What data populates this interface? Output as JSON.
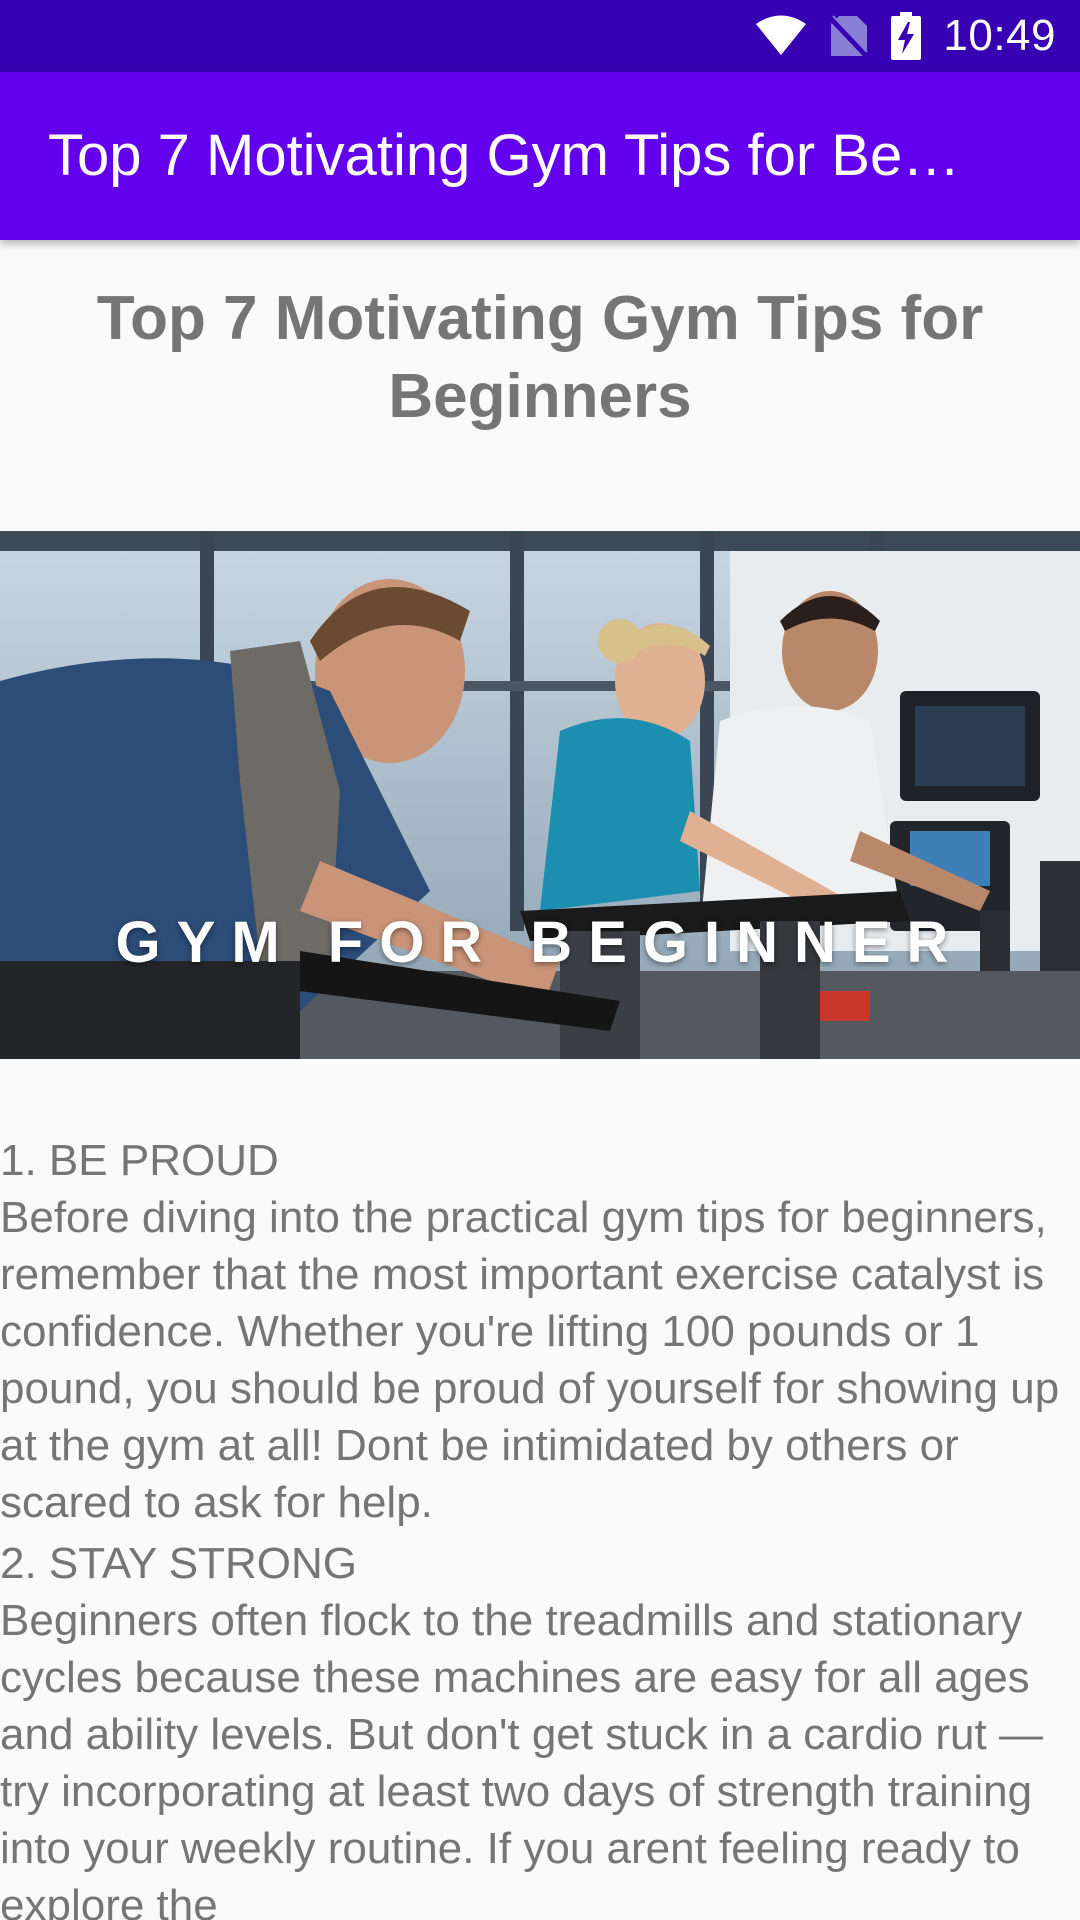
{
  "status_bar": {
    "time": "10:49",
    "icons": [
      "wifi-icon",
      "no-sim-icon",
      "battery-charging-icon"
    ]
  },
  "app_bar": {
    "title": "Top 7 Motivating Gym Tips for Beginners"
  },
  "article": {
    "title": "Top 7 Motivating Gym Tips for Beginners",
    "hero_caption": "GYM FOR BEGINNER",
    "tips": [
      {
        "heading": "1. BE PROUD",
        "text": " Before diving into the practical gym tips for beginners, remember that the most important exercise catalyst is confidence. Whether you're lifting 100 pounds or 1 pound, you should be proud of yourself for showing up at the gym at all! Dont be intimidated by others or scared to ask for help."
      },
      {
        "heading": "2. STAY STRONG",
        "text": " Beginners often flock to the treadmills and stationary cycles because these machines are easy for all ages and ability levels. But don't get stuck in a cardio rut — try incorporating at least two days of strength training into your weekly routine. If you arent feeling ready to explore the"
      }
    ]
  },
  "colors": {
    "status_bar": "#3700b3",
    "app_bar": "#6200ee",
    "background": "#fafafa",
    "text": "#757575"
  }
}
